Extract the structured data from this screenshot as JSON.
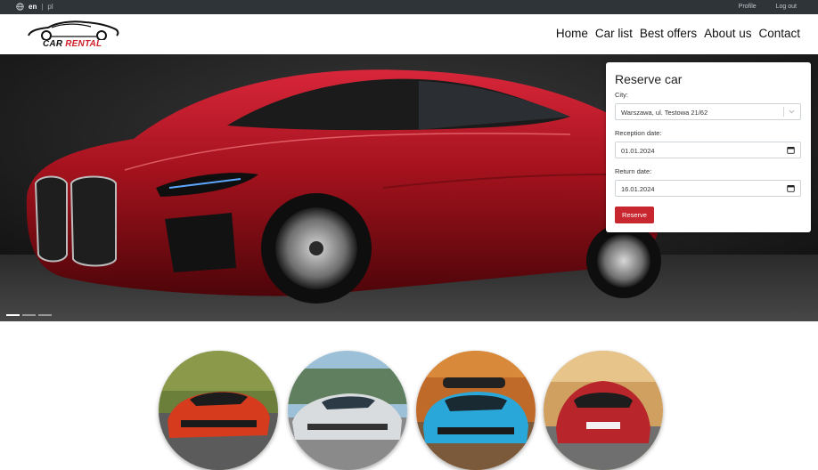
{
  "topbar": {
    "lang_active": "en",
    "lang_separator": "|",
    "lang_inactive": "pl",
    "profile_label": "Profile",
    "logout_label": "Log out"
  },
  "logo": {
    "word1": "CAR",
    "word2": "RENTAL"
  },
  "nav": {
    "items": [
      "Home",
      "Car list",
      "Best offers",
      "About us",
      "Contact"
    ]
  },
  "hero": {
    "slides_count": 3,
    "active_slide": 1
  },
  "reserve": {
    "title": "Reserve car",
    "city_label": "City:",
    "city_value": "Warszawa, ul. Testowa 21/62",
    "reception_label": "Reception date:",
    "reception_value": "01.01.2024",
    "return_label": "Return date:",
    "return_value": "16.01.2024",
    "button_label": "Reserve"
  },
  "featured_cars": [
    {
      "icon": "orange-sports-car-photo",
      "color": "#d63b1e"
    },
    {
      "icon": "white-sedan-photo",
      "color": "#d9dcde"
    },
    {
      "icon": "blue-suv-photo",
      "color": "#2aa7d9"
    },
    {
      "icon": "red-hatchback-photo",
      "color": "#b8262b"
    }
  ],
  "colors": {
    "topbar_bg": "#2f3439",
    "accent": "#c9272f",
    "hero_car": "#a3121d"
  }
}
